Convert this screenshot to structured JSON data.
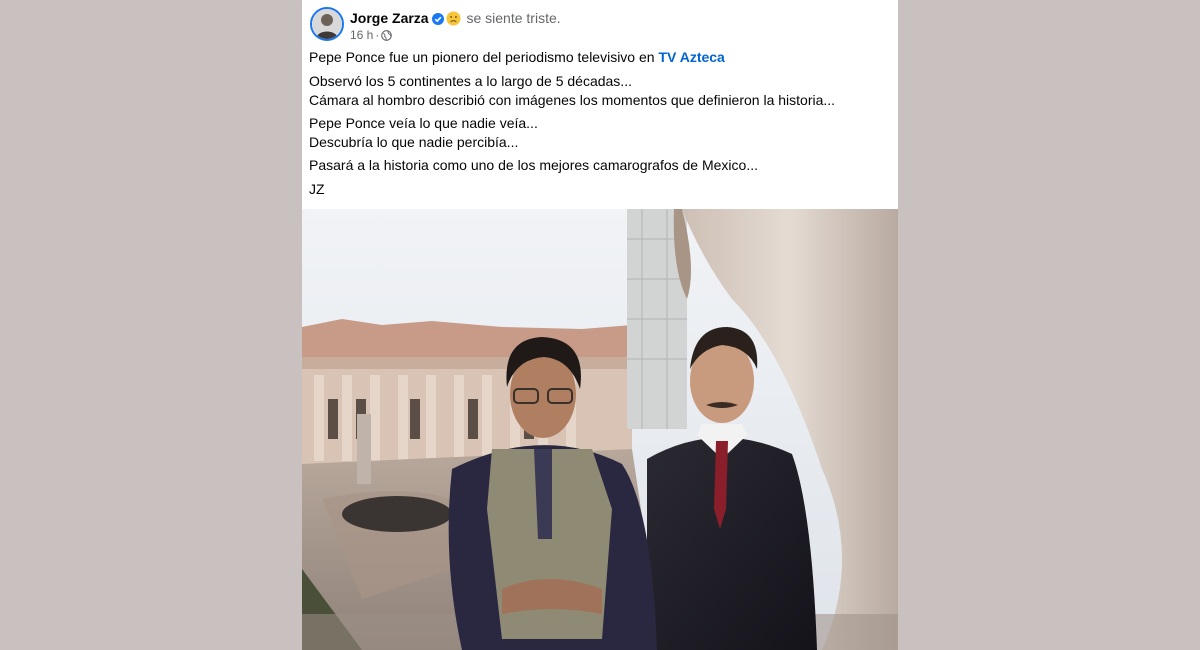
{
  "post": {
    "author": "Jorge Zarza",
    "feeling": "se siente triste.",
    "time": "16 h",
    "separator": "·",
    "icons": {
      "verified": "verified-badge-icon",
      "feeling": "sad-face-emoji-icon",
      "privacy": "globe-icon"
    },
    "text": {
      "line1_prefix": "Pepe Ponce fue un pionero del periodismo televisivo en ",
      "line1_link": "TV Azteca",
      "p2_line1": "Observó los 5 continentes a lo largo de 5 décadas...",
      "p2_line2": "Cámara al hombro describió con imágenes los momentos que definieron la historia...",
      "p3_line1": "Pepe Ponce veía lo que nadie veía...",
      "p3_line2": "Descubría lo que nadie percibía...",
      "p4": "Pasará a la historia como uno de los mejores camarografos de Mexico...",
      "signature": "JZ"
    }
  },
  "colors": {
    "background": "#c9c1c0",
    "card": "#ffffff",
    "link": "#0064d1",
    "verified": "#1877f2",
    "muted": "#65676b"
  }
}
